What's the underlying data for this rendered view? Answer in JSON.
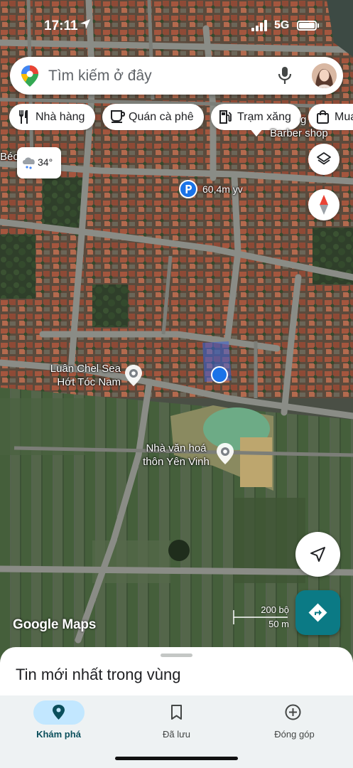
{
  "status_bar": {
    "time": "17:11",
    "network": "5G"
  },
  "search": {
    "placeholder": "Tìm kiếm ở đây"
  },
  "chips": [
    {
      "label": "Nhà hàng",
      "icon": "restaurant-icon"
    },
    {
      "label": "Quán cà phê",
      "icon": "coffee-icon"
    },
    {
      "label": "Trạm xăng",
      "icon": "gas-station-icon"
    },
    {
      "label": "Mua",
      "icon": "shopping-bag-icon"
    }
  ],
  "map": {
    "weather": {
      "temperature": "34°",
      "icon": "cloud-rain-icon"
    },
    "parking": {
      "label": "60,4m yv",
      "icon": "parking-icon"
    },
    "labels": {
      "barber_partial": "Barber shop",
      "barber_prefix": "g",
      "beo_partial": "Béo",
      "poi_1_line1": "Luân Chel Sea",
      "poi_1_line2": "Hớt Tóc Nam",
      "poi_2_line1": "Nhà văn hoá",
      "poi_2_line2": "thôn Yên Vinh"
    },
    "scale": {
      "top": "200 bộ",
      "bottom": "50 m"
    },
    "attribution": "Google Maps",
    "colors": {
      "accent": "#0b7a85",
      "location": "#1a73e8",
      "compass_red": "#ea4335"
    }
  },
  "sheet": {
    "title": "Tin mới nhất trong vùng"
  },
  "bottom_nav": [
    {
      "label": "Khám phá",
      "icon": "location-pin-icon",
      "active": true
    },
    {
      "label": "Đã lưu",
      "icon": "bookmark-icon",
      "active": false
    },
    {
      "label": "Đóng góp",
      "icon": "add-circle-icon",
      "active": false
    }
  ]
}
